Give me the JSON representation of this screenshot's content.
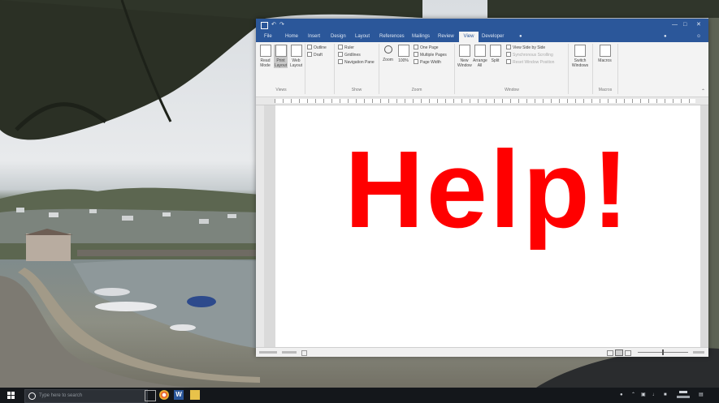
{
  "document": {
    "body_text": "Help!"
  },
  "ribbon": {
    "tabs": [
      "File",
      "Home",
      "Insert",
      "Design",
      "Layout",
      "References",
      "Mailings",
      "Review",
      "View",
      "Developer"
    ],
    "active_tab": "View",
    "groups": [
      "Views",
      "Show",
      "Zoom",
      "Window",
      "Macros"
    ],
    "views": [
      "Read Mode",
      "Print Layout",
      "Web Layout",
      "Outline",
      "Draft"
    ],
    "show": [
      "Ruler",
      "Gridlines",
      "Navigation Pane"
    ],
    "zoom": [
      "Zoom",
      "100%",
      "One Page",
      "Multiple Pages",
      "Page Width"
    ],
    "window": [
      "New Window",
      "Arrange All",
      "Split",
      "View Side by Side",
      "Synchronous Scrolling",
      "Reset Window Position",
      "Switch Windows"
    ],
    "macros": [
      "Macros"
    ]
  },
  "taskbar": {
    "search_placeholder": "Type here to search"
  },
  "colors": {
    "word_blue": "#2b579a",
    "help_red": "#ff0000",
    "taskbar": "#14171b"
  }
}
